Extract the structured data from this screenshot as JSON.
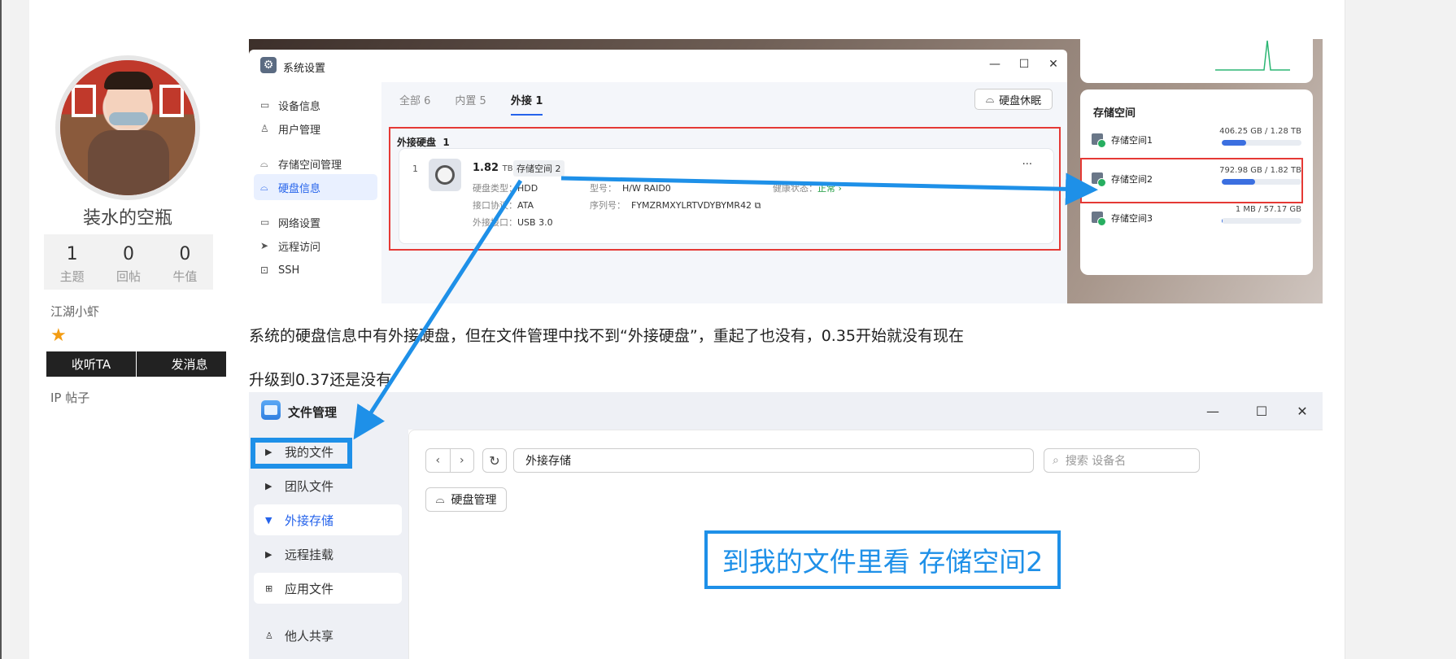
{
  "author": {
    "name": "装水的空瓶",
    "stats": [
      {
        "num": "1",
        "label": "主题"
      },
      {
        "num": "0",
        "label": "回帖"
      },
      {
        "num": "0",
        "label": "牛值"
      }
    ],
    "rank": "江湖小虾",
    "star": "★",
    "follow_label": "收听TA",
    "message_label": "发消息",
    "ip_label": "IP 帖子"
  },
  "shot1": {
    "window_title": "系统设置",
    "app_icon": "⚙",
    "controls": {
      "minimize": "—",
      "maximize": "☐",
      "close": "✕"
    },
    "nav": [
      {
        "label": "设备信息",
        "icon": "▭"
      },
      {
        "label": "用户管理",
        "icon": "♙"
      },
      {
        "label": "存储空间管理",
        "icon": "⌓"
      },
      {
        "label": "硬盘信息",
        "icon": "⌓"
      },
      {
        "label": "网络设置",
        "icon": "▭"
      },
      {
        "label": "远程访问",
        "icon": "➤"
      },
      {
        "label": "SSH",
        "icon": "⊡"
      }
    ],
    "tabs": [
      "全部 6",
      "内置 5",
      "外接 1"
    ],
    "sleep_button": "硬盘休眠",
    "ext_title": "外接硬盘",
    "ext_count": "1",
    "disk": {
      "index": "1",
      "size": "1.82",
      "size_unit": "TB",
      "pool": "存储空间 2",
      "more": "···",
      "type_k": "硬盘类型：",
      "type_v": "HDD",
      "model_k": "型号：",
      "model_v": "H/W RAID0",
      "health_k": "健康状态：",
      "health_v": "正常 ›",
      "iface_k": "接口协议：",
      "iface_v": "ATA",
      "serial_k": "序列号：",
      "serial_v": "FYMZRMXYLRTVDYBYMR42",
      "port_k": "外接接口：",
      "port_v": "USB 3.0"
    },
    "storage_title": "存储空间",
    "pools": [
      {
        "name": "存储空间1",
        "cap": "406.25 GB / 1.28 TB",
        "fill": 0.31
      },
      {
        "name": "存储空间2",
        "cap": "792.98 GB / 1.82 TB",
        "fill": 0.42
      },
      {
        "name": "存储空间3",
        "cap": "1 MB / 57.17 GB",
        "fill": 0.01
      }
    ]
  },
  "text1": "系统的硬盘信息中有外接硬盘，但在文件管理中找不到“外接硬盘”，重起了也没有，0.35开始就没有现在",
  "text2": "升级到0.37还是没有",
  "shot2": {
    "window_title": "文件管理",
    "controls": {
      "minimize": "—",
      "maximize": "☐",
      "close": "✕"
    },
    "nav": [
      {
        "label": "我的文件",
        "icon": "▶"
      },
      {
        "label": "团队文件",
        "icon": "▶"
      },
      {
        "label": "外接存储",
        "icon": "▼"
      },
      {
        "label": "远程挂载",
        "icon": "▶"
      },
      {
        "label": "应用文件",
        "icon": "⊞"
      },
      {
        "label": "他人共享",
        "icon": "♙"
      }
    ],
    "back": "‹",
    "forward": "›",
    "refresh": "↻",
    "path": "外接存储",
    "search_placeholder": "搜索 设备名",
    "search_icon": "⌕",
    "disk_manage": "硬盘管理",
    "disk_manage_icon": "⌓",
    "callout": "到我的文件里看 存储空间2"
  }
}
